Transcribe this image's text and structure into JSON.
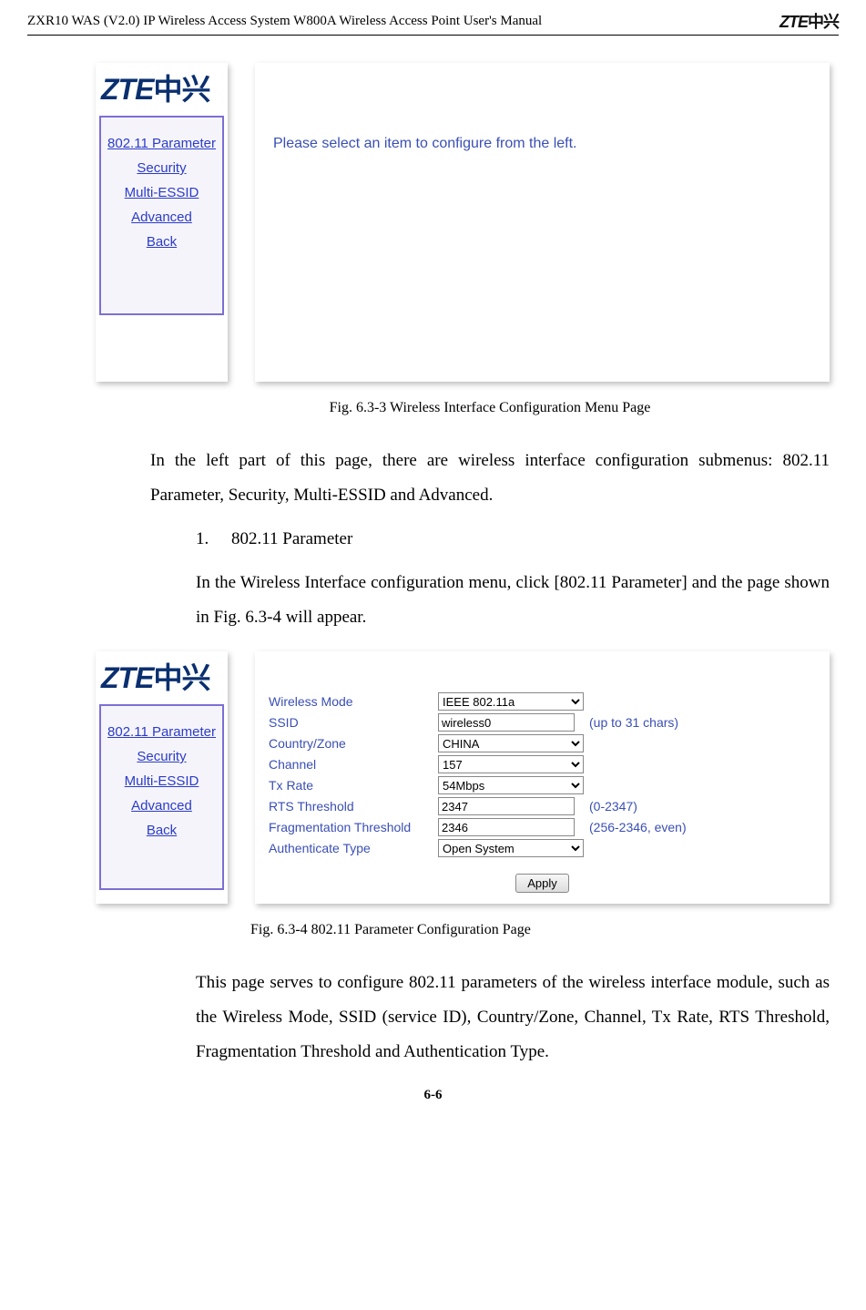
{
  "header": {
    "title": "ZXR10 WAS (V2.0) IP Wireless Access System W800A Wireless Access Point User's Manual",
    "brand_latin": "ZTE",
    "brand_cjk": "中兴"
  },
  "page_number": "6-6",
  "fig1": {
    "brand_latin": "ZTE",
    "brand_cjk": "中兴",
    "nav": {
      "item0": "802.11 Parameter",
      "item1": "Security",
      "item2": "Multi-ESSID",
      "item3": "Advanced",
      "item4": "Back"
    },
    "prompt": "Please select an item to configure from the left.",
    "caption": "Fig. 6.3-3   Wireless Interface Configuration Menu Page"
  },
  "para1": "In the left part of this page, there are wireless interface configuration submenus: 802.11 Parameter, Security, Multi-ESSID and Advanced.",
  "list1_num": "1.",
  "list1_text": "802.11 Parameter",
  "para2": "In the  Wireless Interface configuration menu, click [802.11 Parameter] and the page shown in Fig. 6.3-4 will appear.",
  "fig2": {
    "brand_latin": "ZTE",
    "brand_cjk": "中兴",
    "nav": {
      "item0": "802.11 Parameter",
      "item1": "Security",
      "item2": "Multi-ESSID",
      "item3": "Advanced",
      "item4": "Back"
    },
    "labels": {
      "wmode": "Wireless Mode",
      "ssid": "SSID",
      "country": "Country/Zone",
      "channel": "Channel",
      "txrate": "Tx Rate",
      "rts": "RTS Threshold",
      "frag": "Fragmentation Threshold",
      "auth": "Authenticate Type"
    },
    "values": {
      "wmode": "IEEE 802.11a",
      "ssid": "wireless0",
      "country": "CHINA",
      "channel": "157",
      "txrate": "54Mbps",
      "rts": "2347",
      "frag": "2346",
      "auth": "Open System"
    },
    "hints": {
      "ssid": "(up to 31 chars)",
      "rts": "(0-2347)",
      "frag": "(256-2346, even)"
    },
    "apply": "Apply",
    "caption": "Fig. 6.3-4   802.11 Parameter Configuration Page"
  },
  "para3": "This page serves to configure 802.11 parameters of the wireless interface module, such as the  Wireless Mode, SSID (service ID), Country/Zone, Channel, Tx Rate, RTS Threshold, Fragmentation Threshold and Authentication Type."
}
